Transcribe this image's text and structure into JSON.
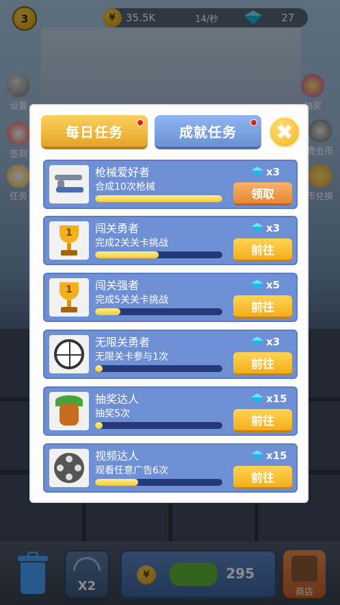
{
  "topbar": {
    "level": "3",
    "coins": "35.5K",
    "rate": "14/秒",
    "gems": "27"
  },
  "side_left": [
    {
      "label": "设置",
      "icon": "gear-icon"
    },
    {
      "label": "签到",
      "icon": "calendar-icon"
    },
    {
      "label": "任务",
      "icon": "task-icon"
    }
  ],
  "side_right": [
    {
      "label": "抽奖",
      "icon": "wheel-icon"
    },
    {
      "label": "费金币",
      "icon": "video-icon"
    },
    {
      "label": "币兑换",
      "icon": "exchange-icon"
    }
  ],
  "modal": {
    "tab_daily": "每日任务",
    "tab_achievement": "成就任务",
    "close_symbol": "✖"
  },
  "tasks": [
    {
      "title": "枪械爱好者",
      "desc": "合成10次枪械",
      "reward": "x3",
      "progress": 1.0,
      "button": "领取",
      "button_type": "claim",
      "icon": "guns-icon"
    },
    {
      "title": "闯关勇者",
      "desc": "完成2关关卡挑战",
      "reward": "x3",
      "progress": 0.5,
      "button": "前往",
      "button_type": "go",
      "icon": "trophy-icon"
    },
    {
      "title": "闯关强者",
      "desc": "完成5关关卡挑战",
      "reward": "x5",
      "progress": 0.2,
      "button": "前往",
      "button_type": "go",
      "icon": "trophy-icon"
    },
    {
      "title": "无限关勇者",
      "desc": "无限关卡参与1次",
      "reward": "x3",
      "progress": 0.06,
      "button": "前往",
      "button_type": "go",
      "icon": "dial-icon"
    },
    {
      "title": "抽奖达人",
      "desc": "抽奖5次",
      "reward": "x15",
      "progress": 0.06,
      "button": "前往",
      "button_type": "go",
      "icon": "mask-icon"
    },
    {
      "title": "视频达人",
      "desc": "观看任意广告6次",
      "reward": "x15",
      "progress": 0.34,
      "button": "前往",
      "button_type": "go",
      "icon": "film-reel-icon"
    }
  ],
  "bottom": {
    "speed_label": "X2",
    "buy_price": "295",
    "shop_label": "商店"
  }
}
